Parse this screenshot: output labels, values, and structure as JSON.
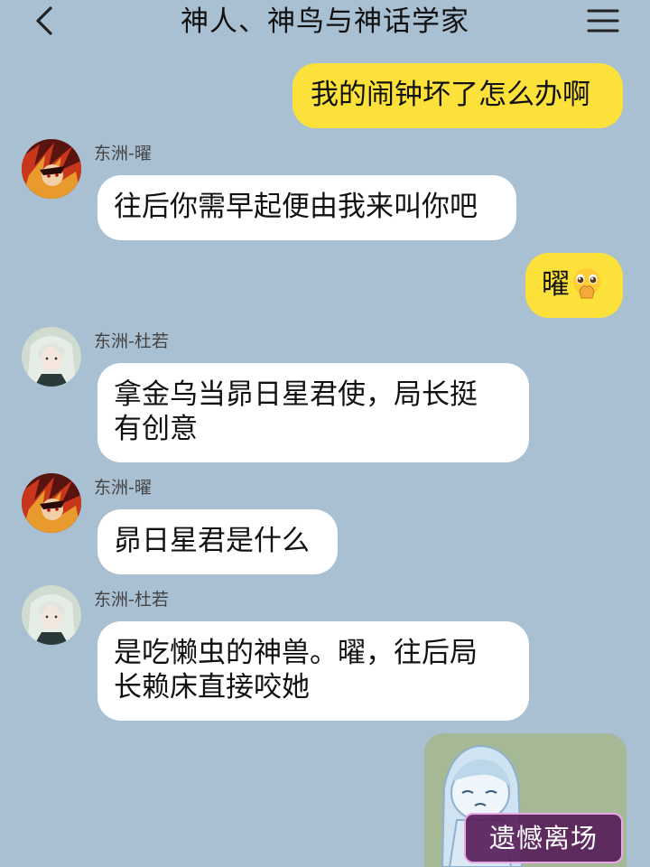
{
  "header": {
    "title": "神人、神鸟与神话学家",
    "back_icon": "chevron-left-icon",
    "menu_icon": "hamburger-menu-icon"
  },
  "messages": [
    {
      "side": "me",
      "text": "我的闹钟坏了怎么办啊"
    },
    {
      "side": "other",
      "sender": "东洲-曜",
      "text": "往后你需早起便由我来叫你吧"
    },
    {
      "side": "me",
      "text": "曜",
      "emoji": "pleading-face-icon"
    },
    {
      "side": "other",
      "sender": "东洲-杜若",
      "line1": "拿金乌当昴日星君使，局长挺",
      "line2": "有创意"
    },
    {
      "side": "other",
      "sender": "东洲-曜",
      "text": "昴日星君是什么"
    },
    {
      "side": "other",
      "sender": "东洲-杜若",
      "line1": "是吃懒虫的神兽。曜，往后局",
      "line2": "长赖床直接咬她"
    },
    {
      "side": "me",
      "sticker_caption": "遗憾离场"
    }
  ],
  "colors": {
    "background": "#a9bfd2",
    "my_bubble": "#fce13b",
    "other_bubble": "#ffffff"
  }
}
